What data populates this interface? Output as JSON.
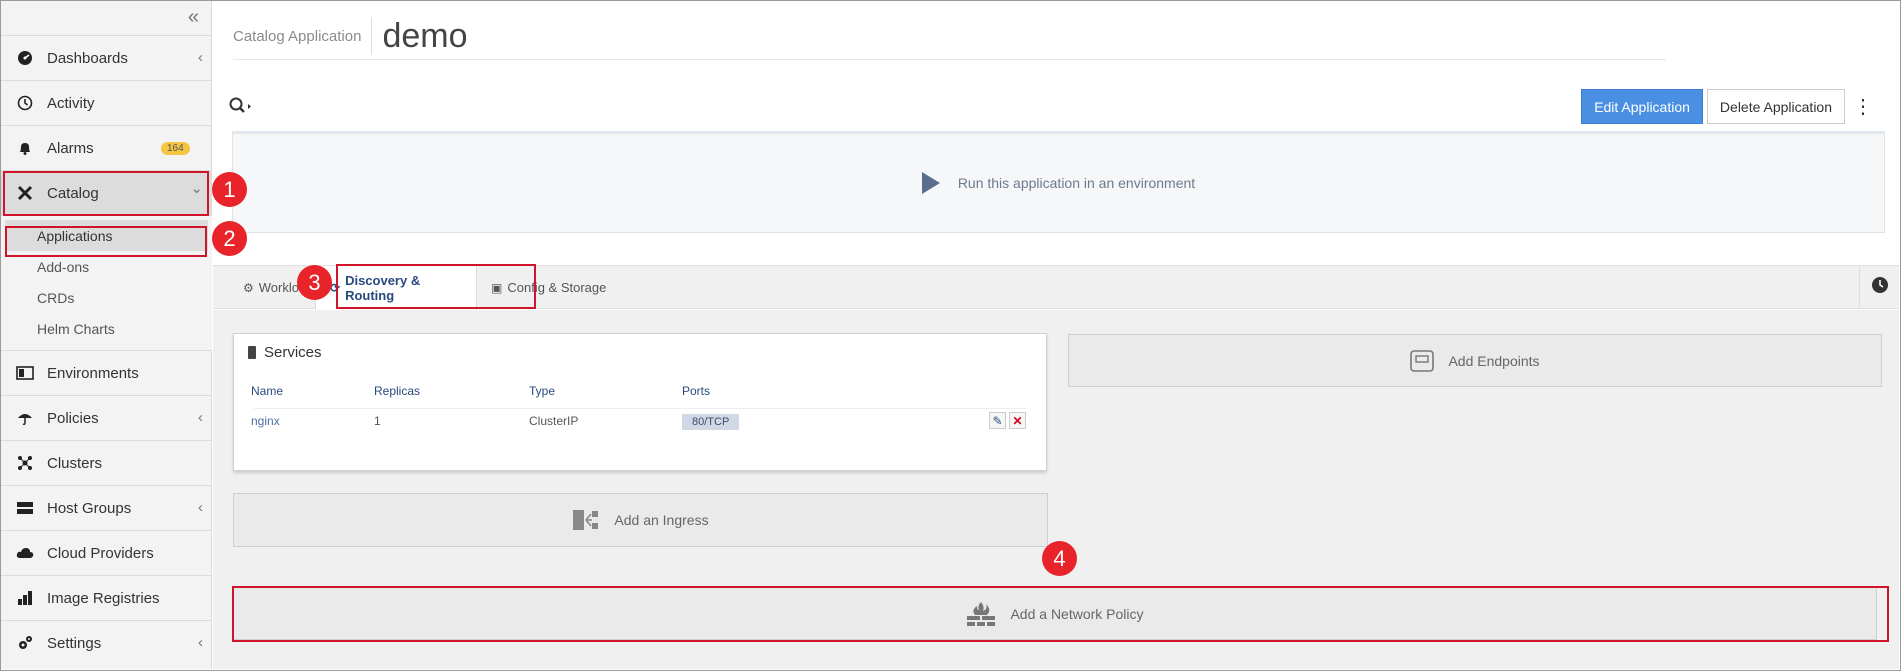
{
  "sidebar": {
    "collapse_icon": "«",
    "items": [
      {
        "label": "Dashboards",
        "icon": "dashboard-icon",
        "chevron": "‹"
      },
      {
        "label": "Activity",
        "icon": "activity-icon"
      },
      {
        "label": "Alarms",
        "icon": "bell-icon",
        "badge": "164"
      },
      {
        "label": "Catalog",
        "icon": "catalog-icon",
        "chevron": "⌄"
      },
      {
        "label": "Environments",
        "icon": "environments-icon"
      },
      {
        "label": "Policies",
        "icon": "umbrella-icon",
        "chevron": "‹"
      },
      {
        "label": "Clusters",
        "icon": "clusters-icon"
      },
      {
        "label": "Host Groups",
        "icon": "server-icon",
        "chevron": "‹"
      },
      {
        "label": "Cloud Providers",
        "icon": "cloud-icon"
      },
      {
        "label": "Image Registries",
        "icon": "registry-icon"
      },
      {
        "label": "Settings",
        "icon": "gears-icon",
        "chevron": "‹"
      }
    ],
    "catalog_sub": [
      "Applications",
      "Add-ons",
      "CRDs",
      "Helm Charts"
    ]
  },
  "header": {
    "breadcrumb": "Catalog Application",
    "title": "demo"
  },
  "toolbar": {
    "edit_label": "Edit Application",
    "delete_label": "Delete Application",
    "search_icon": "search-icon"
  },
  "run": {
    "label": "Run this application in an environment"
  },
  "tabs": [
    "Workloads",
    "Discovery & Routing",
    "Config & Storage"
  ],
  "services": {
    "title": "Services",
    "columns": [
      "Name",
      "Replicas",
      "Type",
      "Ports"
    ],
    "rows": [
      {
        "name": "nginx",
        "replicas": "1",
        "type": "ClusterIP",
        "ports": "80/TCP"
      }
    ]
  },
  "buttons": {
    "add_endpoints": "Add Endpoints",
    "add_ingress": "Add an Ingress",
    "add_network_policy": "Add a Network Policy"
  },
  "callouts": [
    "1",
    "2",
    "3",
    "4"
  ],
  "colors": {
    "primary": "#4a90e2",
    "highlight": "#d0152b",
    "callout": "#e8232a",
    "badge": "#f5c542"
  }
}
